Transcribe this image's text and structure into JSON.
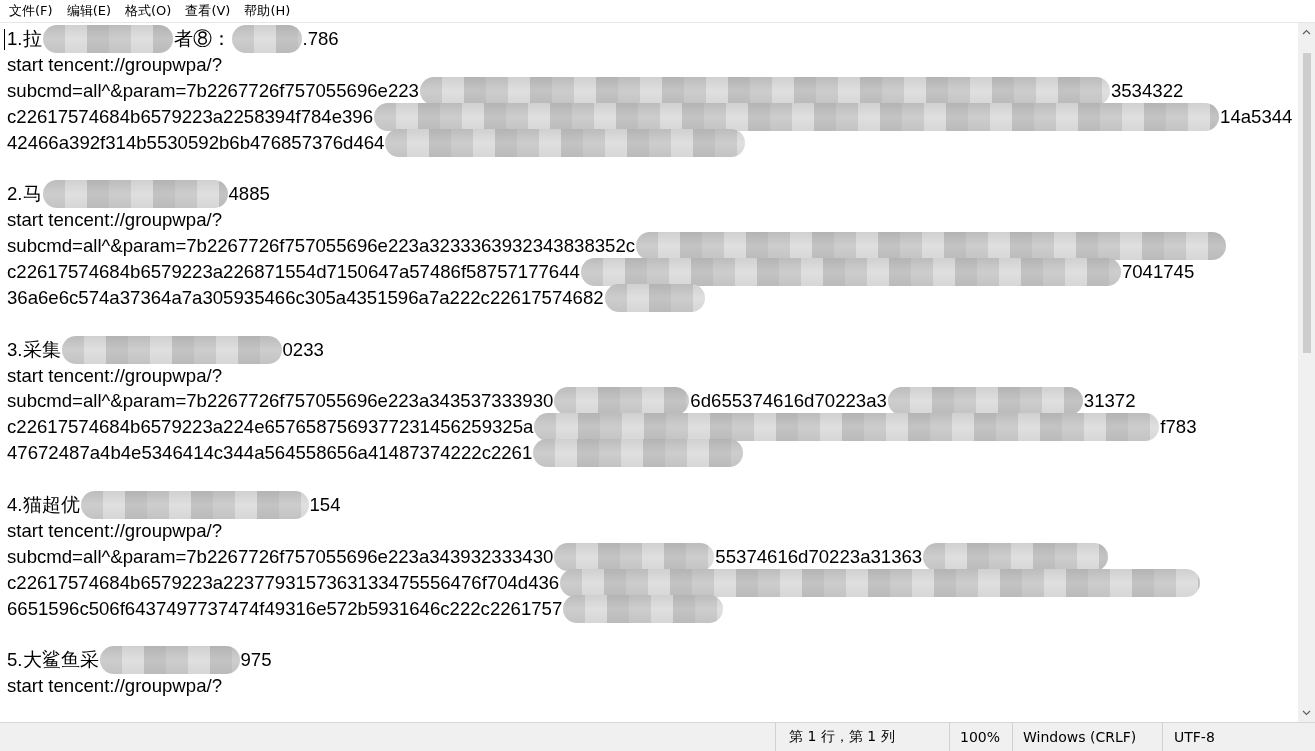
{
  "menu": [
    {
      "label": "文件(F)"
    },
    {
      "label": "编辑(E)"
    },
    {
      "label": "格式(O)"
    },
    {
      "label": "查看(V)"
    },
    {
      "label": "帮助(H)"
    }
  ],
  "document": {
    "blocks": [
      {
        "lines": [
          [
            {
              "kind": "text",
              "text": "1.拉"
            },
            {
              "kind": "blur"
            },
            {
              "kind": "text",
              "text": "者⑧："
            },
            {
              "kind": "blur"
            },
            {
              "kind": "text",
              "text": ".786"
            }
          ],
          [
            {
              "kind": "text",
              "text": "start tencent://groupwpa/?"
            }
          ],
          [
            {
              "kind": "text",
              "text": "subcmd=all^&param=7b2267726f757055696e223"
            },
            {
              "kind": "blur"
            },
            {
              "kind": "text",
              "text": "3534322"
            }
          ],
          [
            {
              "kind": "text",
              "text": "c22617574684b6579223a2258394f784e396"
            },
            {
              "kind": "blur"
            },
            {
              "kind": "text",
              "text": "14a5344"
            }
          ],
          [
            {
              "kind": "text",
              "text": "42466a392f314b5530592b6b476857376d464"
            },
            {
              "kind": "blur"
            }
          ]
        ]
      },
      {
        "lines": [
          [
            {
              "kind": "text",
              "text": "2.马"
            },
            {
              "kind": "blur"
            },
            {
              "kind": "text",
              "text": "4885"
            }
          ],
          [
            {
              "kind": "text",
              "text": "start tencent://groupwpa/?"
            }
          ],
          [
            {
              "kind": "text",
              "text": "subcmd=all^&param=7b2267726f757055696e223a3233363932343838352c"
            },
            {
              "kind": "blur"
            }
          ],
          [
            {
              "kind": "text",
              "text": "c22617574684b6579223a226871554d7150647a57486f58757177644"
            },
            {
              "kind": "blur"
            },
            {
              "kind": "text",
              "text": "7041745"
            }
          ],
          [
            {
              "kind": "text",
              "text": "36a6e6c574a37364a7a305935466c305a4351596a7a222c22617574682"
            },
            {
              "kind": "blur"
            }
          ]
        ]
      },
      {
        "lines": [
          [
            {
              "kind": "text",
              "text": "3.采集"
            },
            {
              "kind": "blur"
            },
            {
              "kind": "text",
              "text": "0233"
            }
          ],
          [
            {
              "kind": "text",
              "text": "start tencent://groupwpa/?"
            }
          ],
          [
            {
              "kind": "text",
              "text": "subcmd=all^&param=7b2267726f757055696e223a343537333930"
            },
            {
              "kind": "blur"
            },
            {
              "kind": "text",
              "text": "6d655374616d70223a3"
            },
            {
              "kind": "blur"
            },
            {
              "kind": "text",
              "text": "31372"
            }
          ],
          [
            {
              "kind": "text",
              "text": "c22617574684b6579223a224e6576587569377231456259325a"
            },
            {
              "kind": "blur"
            },
            {
              "kind": "text",
              "text": "f783"
            }
          ],
          [
            {
              "kind": "text",
              "text": "47672487a4b4e5346414c344a564558656a41487374222c2261"
            },
            {
              "kind": "blur"
            }
          ]
        ]
      },
      {
        "lines": [
          [
            {
              "kind": "text",
              "text": "4.猫超优"
            },
            {
              "kind": "blur"
            },
            {
              "kind": "text",
              "text": "154"
            }
          ],
          [
            {
              "kind": "text",
              "text": "start tencent://groupwpa/?"
            }
          ],
          [
            {
              "kind": "text",
              "text": "subcmd=all^&param=7b2267726f757055696e223a343932333430"
            },
            {
              "kind": "blur"
            },
            {
              "kind": "text",
              "text": "55374616d70223a31363"
            },
            {
              "kind": "blur"
            }
          ],
          [
            {
              "kind": "text",
              "text": "c22617574684b6579223a2237793157363133475556476f704d436"
            },
            {
              "kind": "blur"
            }
          ],
          [
            {
              "kind": "text",
              "text": "6651596c506f6437497737474f49316e572b5931646c222c2261757"
            },
            {
              "kind": "blur"
            }
          ]
        ]
      },
      {
        "lines": [
          [
            {
              "kind": "text",
              "text": "5.大鲨鱼采"
            },
            {
              "kind": "blur"
            },
            {
              "kind": "text",
              "text": "975"
            }
          ],
          [
            {
              "kind": "text",
              "text": "start tencent://groupwpa/?"
            }
          ]
        ]
      }
    ]
  },
  "status_bar": {
    "position": "第 1 行，第 1 列",
    "zoom": "100%",
    "line_ending": "Windows (CRLF)",
    "encoding": "UTF-8"
  }
}
